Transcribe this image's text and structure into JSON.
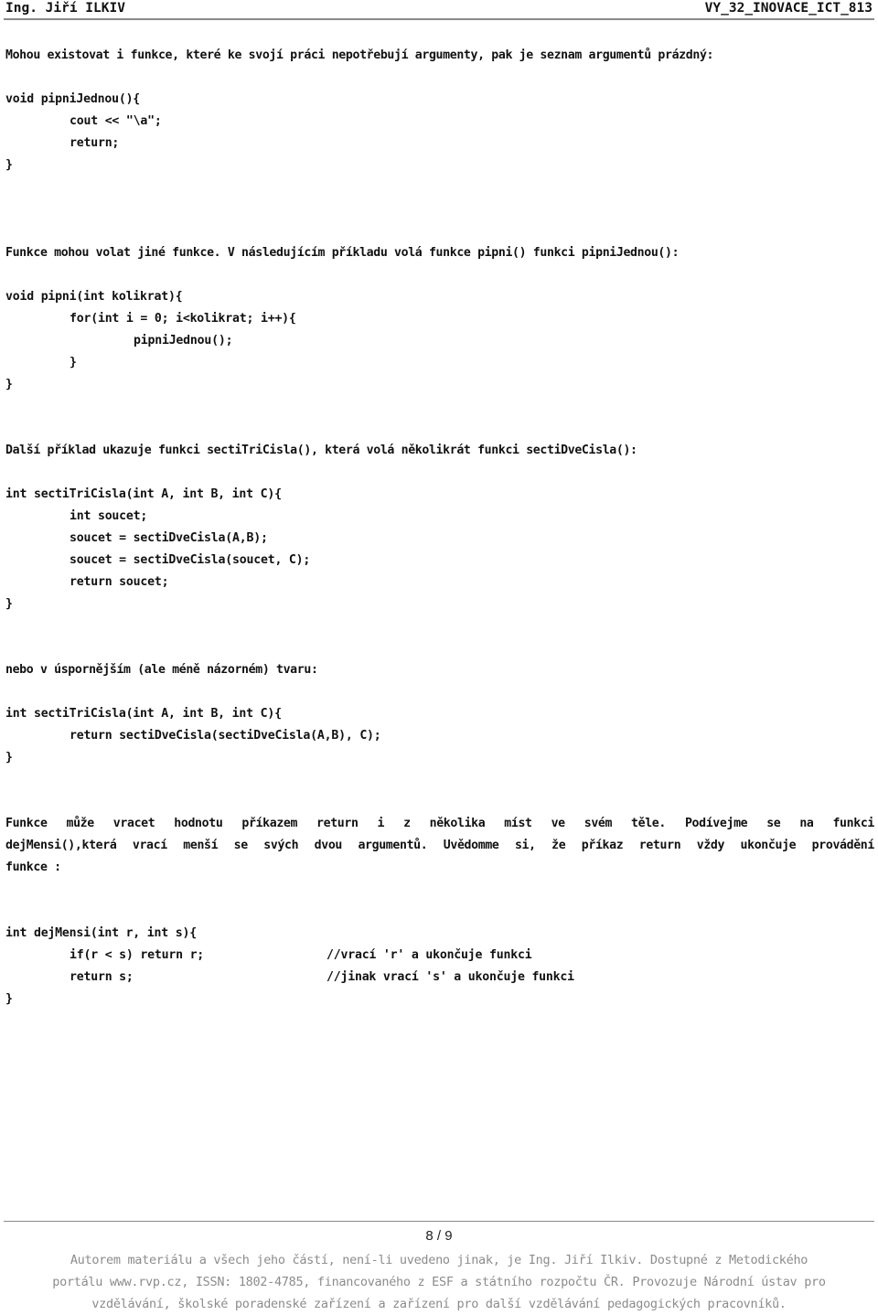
{
  "header": {
    "author": "Ing. Jiří ILKIV",
    "doc_code": "VY_32_INOVACE_ICT_813"
  },
  "sections": {
    "intro_no_args": "Mohou existovat i funkce, které ke svojí práci nepotřebují argumenty, pak je seznam argumentů prázdný:",
    "code_pipni_jednou": [
      "void pipniJednou(){",
      "cout << \"\\a\";",
      "return;",
      "}"
    ],
    "intro_calls": "Funkce mohou volat jiné funkce. V následujícím příkladu volá funkce pipni() funkci pipniJednou():",
    "code_pipni": [
      "void pipni(int kolikrat){",
      "for(int i = 0; i<kolikrat; i++){",
      "pipniJednou();",
      "}",
      "}"
    ],
    "intro_secti": "Další příklad ukazuje funkci sectiTriCisla(), která volá několikrát funkci sectiDveCisla():",
    "code_secti_tri": [
      "int sectiTriCisla(int A, int B, int C){",
      "int soucet;",
      "soucet = sectiDveCisla(A,B);",
      "soucet = sectiDveCisla(soucet, C);",
      "return soucet;",
      "}"
    ],
    "intro_shorter": "nebo v úspornějším (ale méně názorném) tvaru:",
    "code_secti_tri_short": [
      "int sectiTriCisla(int A, int B, int C){",
      "return sectiDveCisla(sectiDveCisla(A,B), C);",
      "}"
    ],
    "intro_return_lines": [
      "Funkce může vracet hodnotu příkazem return i z několika míst ve svém těle. Podívejme se na funkci",
      "dejMensi(),která vrací menší se svých dvou argumentů. Uvědomme si, že příkaz return vždy ukončuje provádění",
      "funkce :"
    ],
    "code_dej_mensi": [
      "int dejMensi(int r, int s){",
      "if(r < s) return r;",
      "return s;",
      "}"
    ],
    "code_dej_mensi_comments": [
      "//vrací 'r' a ukončuje funkci",
      "//jinak vrací 's' a ukončuje funkci"
    ]
  },
  "footer": {
    "page_number": "8 / 9",
    "lines": [
      "Autorem materiálu a všech jeho částí, není-li uvedeno jinak, je Ing. Jiří Ilkiv. Dostupné z Metodického",
      "portálu www.rvp.cz, ISSN: 1802-4785, financovaného z ESF a státního rozpočtu ČR. Provozuje Národní ústav pro",
      "vzdělávání, školské poradenské zařízení a zařízení pro další vzdělávání pedagogických pracovníků."
    ]
  }
}
